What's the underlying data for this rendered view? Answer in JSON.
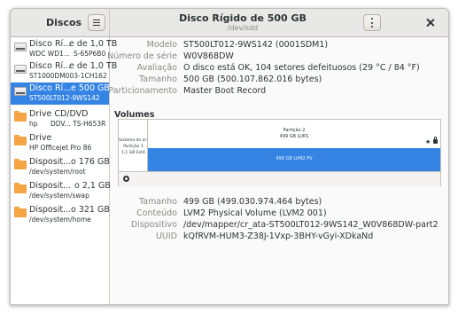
{
  "sidebar_header": {
    "title": "Discos"
  },
  "header": {
    "title": "Disco Rígido de 500 GB",
    "subtitle": "/dev/sdd"
  },
  "sidebar": {
    "items": [
      {
        "line1": "Disco Rí...",
        "size": "e de 1,0 TB",
        "line2": "WDC WD1...",
        "line2b": "S-65P6B0",
        "icon": "hard-disk-icon"
      },
      {
        "line1": "Disco Rí...",
        "size": "e de 1,0 TB",
        "line2": "ST1000DM003-1CH162",
        "line2b": "",
        "icon": "hard-disk-icon"
      },
      {
        "line1": "Disco Rí...",
        "size": "e 500 GB",
        "line2": "ST500LT012-9WS142",
        "line2b": "",
        "icon": "hard-disk-icon",
        "selected": true
      },
      {
        "line1": "Drive CD/DVD",
        "size": "",
        "line2": "hp",
        "line2b": "DDV...  TS-H653R",
        "icon": "optical-drive-icon"
      },
      {
        "line1": "Drive",
        "size": "",
        "line2": "HP Officejet Pro 86",
        "line2b": "",
        "icon": "drive-icon"
      },
      {
        "line1": "Disposit...",
        "size": "o 176 GB",
        "line2": "/dev/system/root",
        "line2b": "",
        "icon": "block-device-icon"
      },
      {
        "line1": "Disposit...",
        "size": "o 2,1 GB",
        "line2": "/dev/system/swap",
        "line2b": "",
        "icon": "block-device-icon"
      },
      {
        "line1": "Disposit...",
        "size": "o 321 GB",
        "line2": "/dev/system/home",
        "line2b": "",
        "icon": "block-device-icon"
      }
    ]
  },
  "disk_info": {
    "model_label": "Modelo",
    "model": "ST500LT012-9WS142 (0001SDM1)",
    "serial_label": "Número de série",
    "serial": "W0V868DW",
    "assessment_label": "Avaliação",
    "assessment": "O disco está OK, 104 setores defeituosos (29 °C / 84 °F)",
    "size_label": "Tamanho",
    "size": "500 GB (500.107.862.016 bytes)",
    "partitioning_label": "Particionamento",
    "partitioning": "Master Boot Record"
  },
  "volumes": {
    "title": "Volumes",
    "p1_lines": [
      "Sistema de ar...",
      "Partição 1",
      "1,1 GB Ext4"
    ],
    "p2_lines": [
      "Partição 2",
      "499 GB LUKS"
    ],
    "lvm_label": "499 GB LVM2 PV"
  },
  "volume_info": {
    "size_label": "Tamanho",
    "size": "499 GB (499.030.974.464 bytes)",
    "content_label": "Conteúdo",
    "content": "LVM2 Physical Volume (LVM2 001)",
    "device_label": "Dispositivo",
    "device": "/dev/mapper/cr_ata-ST500LT012-9WS142_W0V868DW-part2",
    "uuid_label": "UUID",
    "uuid": "kQfRVM-HUM3-Z38J-1Vxp-3BHY-vGyi-XDkaNd"
  },
  "colors": {
    "accent": "#3584e4",
    "folder": "#f5a443"
  }
}
